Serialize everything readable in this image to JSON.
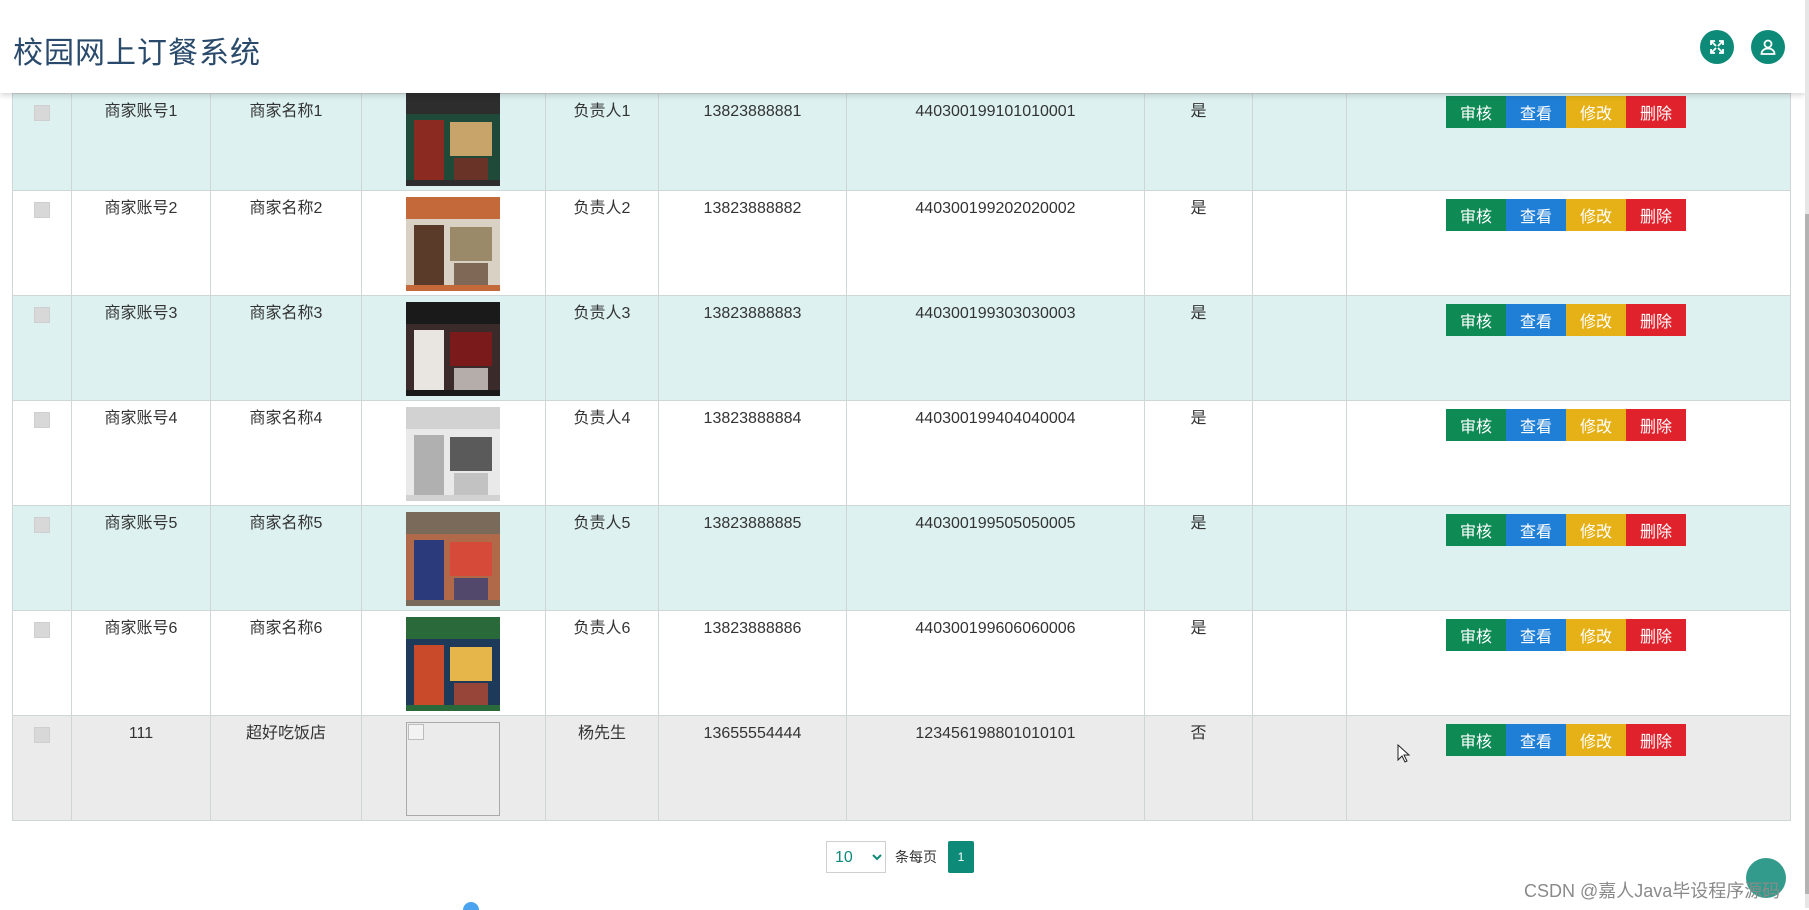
{
  "app": {
    "title": "校园网上订餐系统"
  },
  "header_icons": [
    "fullscreen-icon",
    "user-icon"
  ],
  "actions": {
    "audit": "审核",
    "view": "查看",
    "edit": "修改",
    "delete": "删除"
  },
  "rows": [
    {
      "account": "商家账号1",
      "name": "商家名称1",
      "owner": "负责人1",
      "phone": "13823888881",
      "id_no": "440300199101010001",
      "status": "是",
      "image": "shop-storefront-1"
    },
    {
      "account": "商家账号2",
      "name": "商家名称2",
      "owner": "负责人2",
      "phone": "13823888882",
      "id_no": "440300199202020002",
      "status": "是",
      "image": "shop-storefront-2"
    },
    {
      "account": "商家账号3",
      "name": "商家名称3",
      "owner": "负责人3",
      "phone": "13823888883",
      "id_no": "440300199303030003",
      "status": "是",
      "image": "shop-storefront-3"
    },
    {
      "account": "商家账号4",
      "name": "商家名称4",
      "owner": "负责人4",
      "phone": "13823888884",
      "id_no": "440300199404040004",
      "status": "是",
      "image": "shop-interior-4"
    },
    {
      "account": "商家账号5",
      "name": "商家名称5",
      "owner": "负责人5",
      "phone": "13823888885",
      "id_no": "440300199505050005",
      "status": "是",
      "image": "shop-storefront-5"
    },
    {
      "account": "商家账号6",
      "name": "商家名称6",
      "owner": "负责人6",
      "phone": "13823888886",
      "id_no": "440300199606060006",
      "status": "是",
      "image": "shop-storefront-6"
    },
    {
      "account": "111",
      "name": "超好吃饭店",
      "owner": "杨先生",
      "phone": "13655554444",
      "id_no": "123456198801010101",
      "status": "否",
      "image": "broken-image"
    }
  ],
  "pagination": {
    "page_size": "10",
    "page_size_options": [
      "10"
    ],
    "per_page_label": "条每页",
    "current_page": "1"
  },
  "watermark": "CSDN @嘉人Java毕设程序源码",
  "colors": {
    "accent": "#0e8a78",
    "audit": "#0e8a55",
    "view": "#1f7fd6",
    "edit": "#e6b116",
    "delete": "#e0222d",
    "row_highlight": "#ddf1f1"
  }
}
